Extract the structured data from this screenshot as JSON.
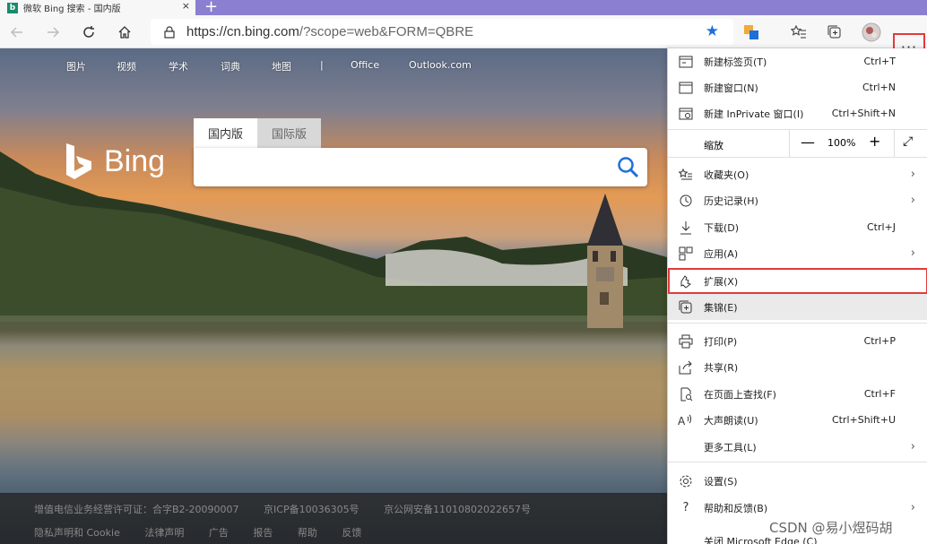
{
  "tab": {
    "title": "微软 Bing 搜索 - 国内版",
    "close": "×",
    "new_tab": "+"
  },
  "address": {
    "url_host": "https://cn.bing.com",
    "url_path": "/?scope=web&FORM=QBRE"
  },
  "icons": [
    "back-icon",
    "forward-icon",
    "refresh-icon",
    "home-icon",
    "lock-icon",
    "star-icon",
    "translate-icon",
    "favorites-icon",
    "collections-icon",
    "profile-icon",
    "more-icon"
  ],
  "more_label": "···",
  "topnav": [
    "图片",
    "视频",
    "学术",
    "词典",
    "地图",
    "|",
    "Office",
    "Outlook.com"
  ],
  "logo_text": "Bing",
  "search_tabs": [
    "国内版",
    "国际版"
  ],
  "footer": {
    "row1": [
      "增值电信业务经营许可证：合字B2-20090007",
      "京ICP备10036305号",
      "京公网安备11010802022657号"
    ],
    "row2": [
      "隐私声明和 Cookie",
      "法律声明",
      "广告",
      "报告",
      "帮助",
      "反馈"
    ]
  },
  "menu": {
    "new_tab": {
      "label": "新建标签页(T)",
      "shortcut": "Ctrl+T"
    },
    "new_window": {
      "label": "新建窗口(N)",
      "shortcut": "Ctrl+N"
    },
    "new_inprivate": {
      "label": "新建 InPrivate 窗口(I)",
      "shortcut": "Ctrl+Shift+N"
    },
    "zoom": {
      "label": "缩放",
      "minus": "—",
      "value": "100%",
      "plus": "+",
      "expand": "⤢"
    },
    "favorites": {
      "label": "收藏夹(O)"
    },
    "history": {
      "label": "历史记录(H)"
    },
    "downloads": {
      "label": "下载(D)",
      "shortcut": "Ctrl+J"
    },
    "apps": {
      "label": "应用(A)"
    },
    "extensions": {
      "label": "扩展(X)"
    },
    "collections": {
      "label": "集锦(E)"
    },
    "print": {
      "label": "打印(P)",
      "shortcut": "Ctrl+P"
    },
    "share": {
      "label": "共享(R)"
    },
    "find": {
      "label": "在页面上查找(F)",
      "shortcut": "Ctrl+F"
    },
    "read_aloud": {
      "label": "大声朗读(U)",
      "shortcut": "Ctrl+Shift+U"
    },
    "more_tools": {
      "label": "更多工具(L)"
    },
    "settings": {
      "label": "设置(S)"
    },
    "help": {
      "label": "帮助和反馈(B)"
    },
    "close_edge": {
      "label": "关闭 Microsoft Edge (C)"
    },
    "arrow": "›"
  },
  "watermark": "CSDN @易小煜码胡",
  "colors": {
    "accent": "#1e6fd9",
    "highlight_border": "#e23b3b",
    "tabstrip": "#8b7fd1"
  }
}
